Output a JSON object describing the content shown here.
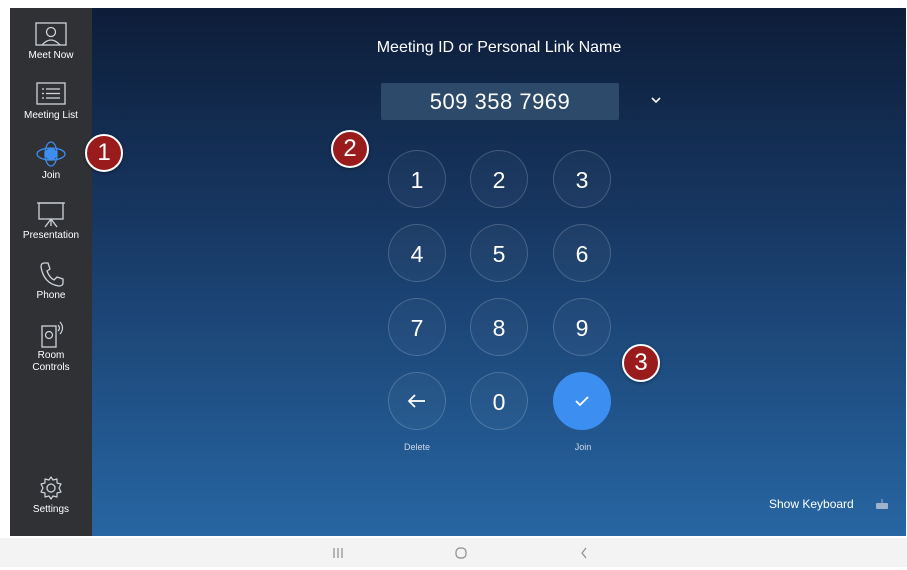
{
  "sidebar": {
    "items": [
      {
        "label": "Meet Now",
        "icon": "meet-now-icon"
      },
      {
        "label": "Meeting List",
        "icon": "meeting-list-icon"
      },
      {
        "label": "Join",
        "icon": "join-icon",
        "active": true
      },
      {
        "label": "Presentation",
        "icon": "presentation-icon"
      },
      {
        "label": "Phone",
        "icon": "phone-icon"
      },
      {
        "label": "Room Controls",
        "icon": "room-controls-icon"
      }
    ],
    "settings_label": "Settings"
  },
  "main": {
    "title": "Meeting ID or Personal Link Name",
    "meeting_id": "509 358 7969",
    "keypad": [
      "1",
      "2",
      "3",
      "4",
      "5",
      "6",
      "7",
      "8",
      "9"
    ],
    "zero": "0",
    "delete_label": "Delete",
    "join_label": "Join",
    "show_keyboard": "Show Keyboard"
  },
  "badges": [
    "1",
    "2",
    "3"
  ],
  "colors": {
    "accent": "#3d8ef1",
    "sidebar_bg": "#2f3135",
    "badge": "#9a1b1b"
  }
}
